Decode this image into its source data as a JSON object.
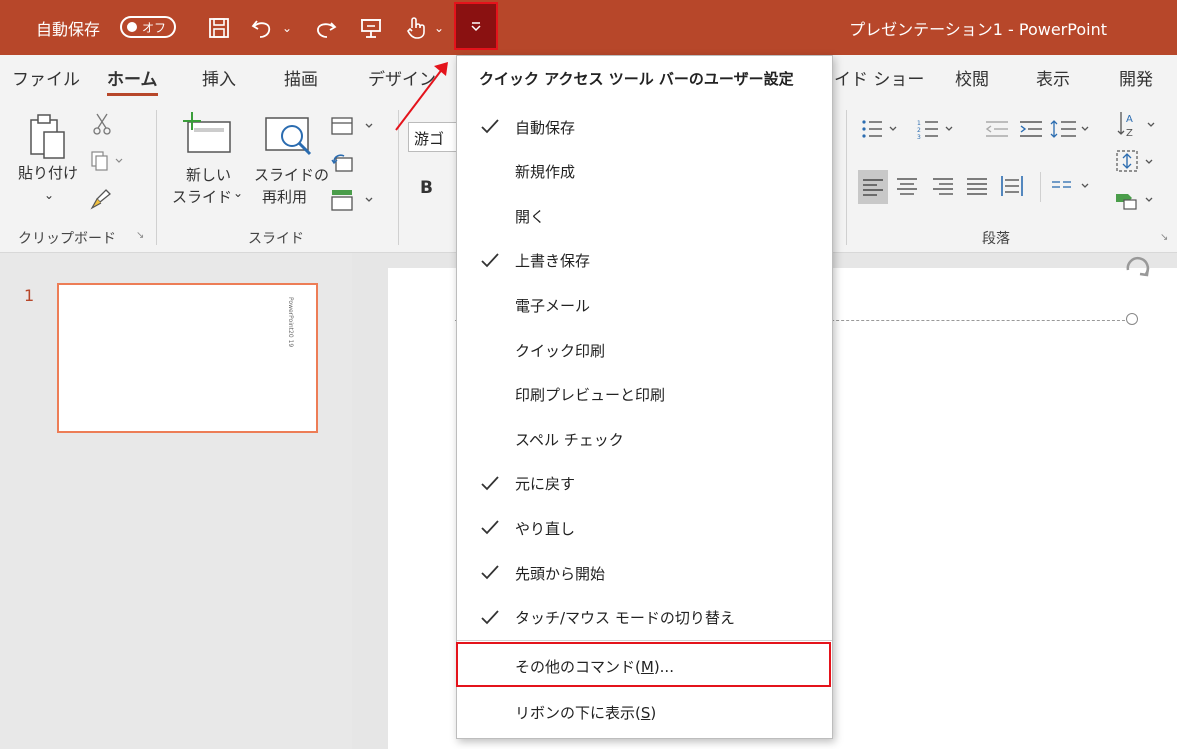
{
  "titlebar": {
    "autosave_label": "自動保存",
    "autosave_state": "オフ",
    "document_title": "プレゼンテーション1 - PowerPoint"
  },
  "tabs": [
    {
      "label": "ファイル",
      "active": false
    },
    {
      "label": "ホーム",
      "active": true
    },
    {
      "label": "挿入",
      "active": false
    },
    {
      "label": "描画",
      "active": false
    },
    {
      "label": "デザイン",
      "active": false
    },
    {
      "label": "イド ショー",
      "active": false
    },
    {
      "label": "校閲",
      "active": false
    },
    {
      "label": "表示",
      "active": false
    },
    {
      "label": "開発",
      "active": false
    }
  ],
  "ribbon": {
    "paste_label": "貼り付け",
    "clipboard_group": "クリップボード",
    "new_slide_line1": "新しい",
    "new_slide_line2": "スライド",
    "reuse_line1": "スライドの",
    "reuse_line2": "再利用",
    "slides_group": "スライド",
    "font_name": "游ゴ",
    "bold_label": "B",
    "paragraph_group": "段落"
  },
  "slides": {
    "number": "1",
    "thumb_text": "PowerPoint20 19"
  },
  "menu": {
    "header": "クイック アクセス ツール バーのユーザー設定",
    "items": [
      {
        "label": "自動保存",
        "checked": true
      },
      {
        "label": "新規作成",
        "checked": false
      },
      {
        "label": "開く",
        "checked": false
      },
      {
        "label": "上書き保存",
        "checked": true
      },
      {
        "label": "電子メール",
        "checked": false
      },
      {
        "label": "クイック印刷",
        "checked": false
      },
      {
        "label": "印刷プレビューと印刷",
        "checked": false
      },
      {
        "label": "スペル チェック",
        "checked": false
      },
      {
        "label": "元に戻す",
        "checked": true
      },
      {
        "label": "やり直し",
        "checked": true
      },
      {
        "label": "先頭から開始",
        "checked": true
      },
      {
        "label": "タッチ/マウス モードの切り替え",
        "checked": true
      }
    ],
    "more_commands_prefix": "その他のコマンド(",
    "more_commands_key": "M",
    "more_commands_suffix": ")...",
    "show_below_prefix": "リボンの下に表示(",
    "show_below_key": "S",
    "show_below_suffix": ")"
  },
  "colors": {
    "accent": "#b7472a",
    "highlight": "#e4131b"
  }
}
